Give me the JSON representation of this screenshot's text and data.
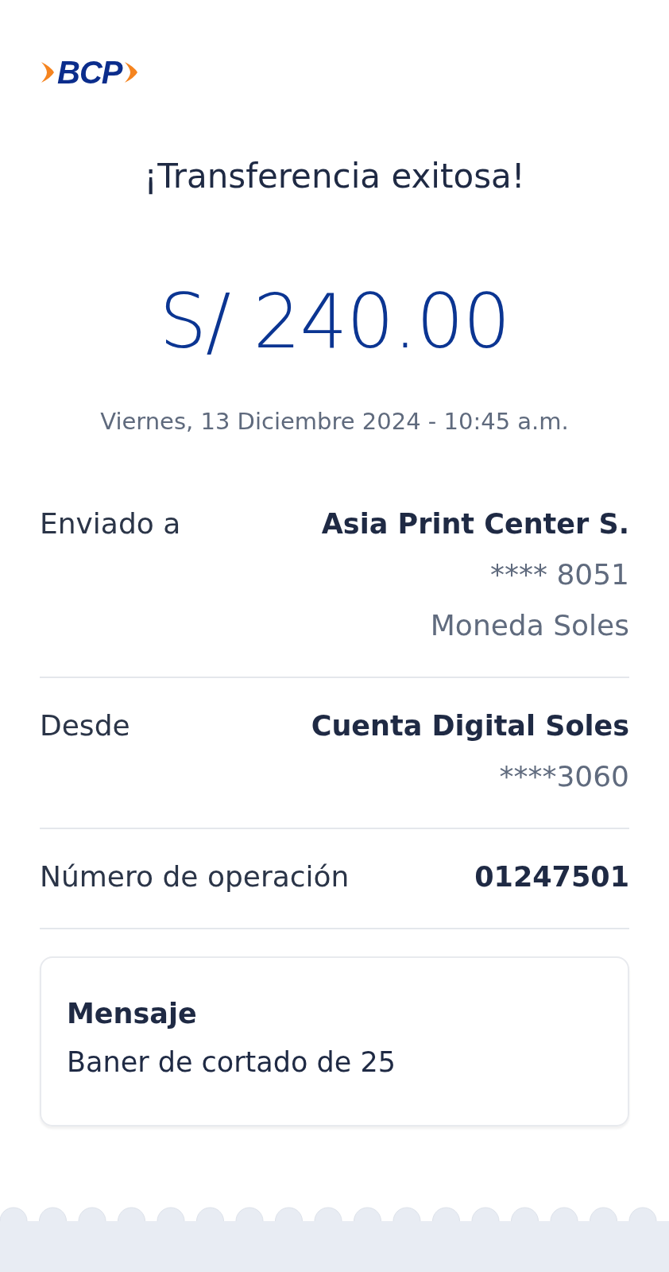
{
  "logo": {
    "text": "BCP"
  },
  "title": "¡Transferencia exitosa!",
  "amount": "S/ 240.00",
  "datetime": "Viernes, 13 Diciembre 2024 - 10:45 a.m.",
  "details": [
    {
      "label": "Enviado a",
      "values": [
        {
          "text": "Asia Print Center S.",
          "kind": "strong"
        },
        {
          "text": "**** 8051",
          "kind": "muted"
        },
        {
          "text": "Moneda Soles",
          "kind": "muted"
        }
      ]
    },
    {
      "label": "Desde",
      "values": [
        {
          "text": "Cuenta Digital Soles",
          "kind": "strong"
        },
        {
          "text": "****3060",
          "kind": "muted"
        }
      ]
    },
    {
      "label": "Número de operación",
      "values": [
        {
          "text": "01247501",
          "kind": "strong"
        }
      ]
    }
  ],
  "message": {
    "title": "Mensaje",
    "text": "Baner de cortado de 25"
  }
}
